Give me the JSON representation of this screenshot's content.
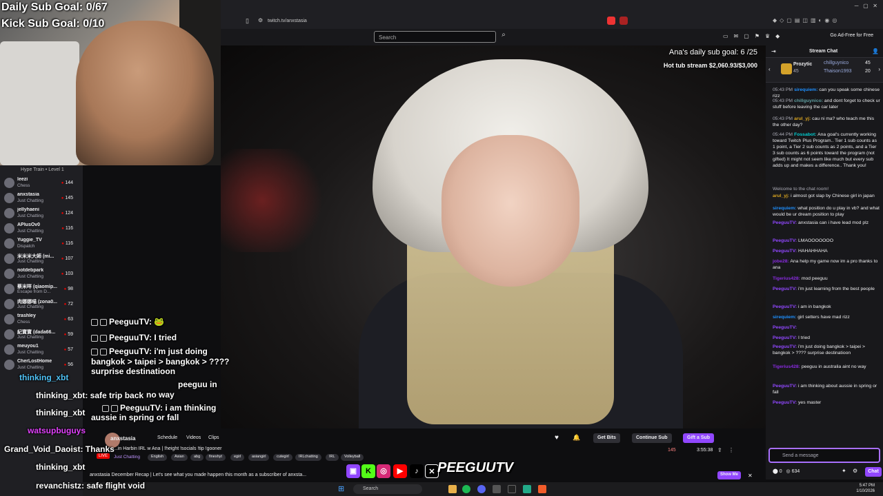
{
  "overlay": {
    "daily_goal": "Daily Sub Goal: 0/67",
    "kick_goal": "Kick Sub Goal: 0/10"
  },
  "browser": {
    "url": "twitch.tv/anxstasia"
  },
  "header": {
    "search_placeholder": "Search",
    "ad_free": "Go Ad-Free for Free"
  },
  "video_overlay": {
    "daily_goal": "Ana's daily sub goal: 6 /25",
    "tub_stream": "Hot tub stream $2,060.93/$3,000"
  },
  "sidebar": {
    "hype_train": "Hype Train • Level 1",
    "follows": [
      {
        "name": "leezi",
        "category": "Chess",
        "viewers": "144"
      },
      {
        "name": "anxstasia",
        "category": "Just Chatting",
        "viewers": "145"
      },
      {
        "name": "jellyhaeni",
        "category": "Just Chatting",
        "viewers": "124"
      },
      {
        "name": "APlusOv0",
        "category": "Just Chatting",
        "viewers": "116"
      },
      {
        "name": "Yuggie_TV",
        "category": "Dispatch",
        "viewers": "116"
      },
      {
        "name": "米米米大師 (mi...",
        "category": "Just Chatting",
        "viewers": "107"
      },
      {
        "name": "notdebpark",
        "category": "Just Chatting",
        "viewers": "103"
      },
      {
        "name": "蔡米咩 (qiaomip...",
        "category": "Escape from D...",
        "viewers": "98"
      },
      {
        "name": "肉娜娜喵 (zona0...",
        "category": "Just Chatting",
        "viewers": "72"
      },
      {
        "name": "trashley",
        "category": "Chess",
        "viewers": "63"
      },
      {
        "name": "紀寶寶 (dada66...",
        "category": "Just Chatting",
        "viewers": "59"
      },
      {
        "name": "meuyou1",
        "category": "Just Chatting",
        "viewers": "57"
      },
      {
        "name": "CherLostHome",
        "category": "Just Chatting",
        "viewers": "56"
      }
    ]
  },
  "video_chat": [
    {
      "user": "PeeguuTV:",
      "text": ""
    },
    {
      "user": "PeeguuTV:",
      "text": "I tried"
    },
    {
      "user": "PeeguuTV:",
      "text": "i'm just doing"
    },
    {
      "user": "",
      "text": "bangkok > taipei > bangkok > ????"
    },
    {
      "user": "",
      "text": "surprise destinatioon"
    },
    {
      "user": "",
      "text": "peeguu in"
    },
    {
      "user": "",
      "text": "no way"
    },
    {
      "user": "PeeguuTV:",
      "text": "i am thinking"
    },
    {
      "user": "",
      "text": "aussie in spring or fall"
    }
  ],
  "bottom_overlay": [
    {
      "user": "thinking_xbt",
      "text": ""
    },
    {
      "user": "thinking_xbt",
      "text": ": safe trip back"
    },
    {
      "user": "thinking_xbt",
      "text": ""
    },
    {
      "user": "watsupbuguys",
      "text": ""
    },
    {
      "user": "Grand_Void_Daoist",
      "text": ": Thanks"
    },
    {
      "user": "thinking_xbt",
      "text": ""
    },
    {
      "user": "revanchistz",
      "text": ": safe flight void"
    }
  ],
  "stream_info": {
    "channel": "anxstasia",
    "live": "LIVE",
    "tabs": [
      "Schedule",
      "Videos",
      "Clips"
    ],
    "title": "...in Harbin IRL w Ana | !height !socials !tip !gooner",
    "category": "Just Chatting",
    "tags": [
      "English",
      "Asian",
      "abg",
      "fineshyt",
      "egirl",
      "asiangirl",
      "cutegirl",
      "IRLchatting",
      "IRL",
      "Volleyball"
    ],
    "viewers": "145",
    "uptime": "3:55:38",
    "get_bits": "Get Bits",
    "continue_sub": "Continue Sub",
    "gift_sub": "Gift a Sub",
    "recap": "anxstasia December Recap | Let's see what you made happen this month as a subscriber of anxsta...",
    "show_me": "Show Me"
  },
  "brand": "PEEGUUTV",
  "chat": {
    "title": "Stream Chat",
    "gifters": [
      {
        "name": "Prozytic",
        "count": "45"
      },
      {
        "name": "chillguynico",
        "count": "45"
      },
      {
        "name": "Thaison1993",
        "count": "20"
      }
    ],
    "messages": [
      {
        "ts": "05:43 PM",
        "user": "sirequiem:",
        "color": "#1e90ff",
        "text": "can you speak some chinese rizz"
      },
      {
        "ts": "05:43 PM",
        "user": "chillguynico:",
        "color": "#5f9ea0",
        "text": "and dont forget to check ur stuff before leaving the car later"
      },
      {
        "ts": "05:43 PM",
        "user": "arul_yj:",
        "color": "#daa520",
        "text": "cau ni ma? who teach me this the other day?"
      },
      {
        "ts": "05:44 PM",
        "user": "Fossabot:",
        "color": "#00ced1",
        "text": "Ana goal's currently working toward Twitch Plus Program.. Tier 1 sub counts as 1 point, a Tier 2 sub counts as 2 points, and a Tier 3 sub counts as 6 points toward the program (not gifted) It might not seem like much but every sub adds up and makes a difference.. Thank you!"
      },
      {
        "ts": "",
        "user": "",
        "color": "#adadb8",
        "text": "Welcome to the chat room!"
      },
      {
        "ts": "",
        "user": "arul_yj:",
        "color": "#daa520",
        "text": "i almost got slap by Chinese girl in japan"
      },
      {
        "ts": "",
        "user": "sirequiem:",
        "color": "#1e90ff",
        "text": "what position do u play in vb? and what would be ur dream position to play"
      },
      {
        "ts": "",
        "user": "PeeguuTV:",
        "color": "#9147ff",
        "text": "anxstasia can i have lead mod plz"
      },
      {
        "ts": "",
        "user": "PeeguuTV:",
        "color": "#9147ff",
        "text": "LMAOOOOOOO"
      },
      {
        "ts": "",
        "user": "PeeguuTV:",
        "color": "#9147ff",
        "text": "HAHAHHAHA"
      },
      {
        "ts": "",
        "user": "jobe28:",
        "color": "#8a2be2",
        "text": "Ana help my game now im a pro thanks to ana"
      },
      {
        "ts": "",
        "user": "Tigerius428:",
        "color": "#8a2be2",
        "text": "mod peeguu"
      },
      {
        "ts": "",
        "user": "PeeguuTV:",
        "color": "#9147ff",
        "text": "i'm just learning from the best people"
      },
      {
        "ts": "",
        "user": "PeeguuTV:",
        "color": "#9147ff",
        "text": "i am in bangkok"
      },
      {
        "ts": "",
        "user": "sirequiem:",
        "color": "#1e90ff",
        "text": "girl setters have mad rizz"
      },
      {
        "ts": "",
        "user": "PeeguuTV:",
        "color": "#9147ff",
        "text": ""
      },
      {
        "ts": "",
        "user": "PeeguuTV:",
        "color": "#9147ff",
        "text": "I tried"
      },
      {
        "ts": "",
        "user": "PeeguuTV:",
        "color": "#9147ff",
        "text": "i'm just doing bangkok > taipei > bangkok > ???? surprise destinatioon"
      },
      {
        "ts": "",
        "user": "Tigerius428:",
        "color": "#8a2be2",
        "text": "peeguu in australia aint no way"
      },
      {
        "ts": "",
        "user": "PeeguuTV:",
        "color": "#9147ff",
        "text": "i am thinking about aussie in spring or fall"
      },
      {
        "ts": "",
        "user": "PeeguuTV:",
        "color": "#9147ff",
        "text": "yes master"
      }
    ],
    "input_placeholder": "Send a message",
    "points": "0",
    "bits": "634",
    "send_label": "Chat"
  },
  "taskbar": {
    "search": "Search",
    "time": "5:47 PM",
    "date": "1/10/2026"
  }
}
